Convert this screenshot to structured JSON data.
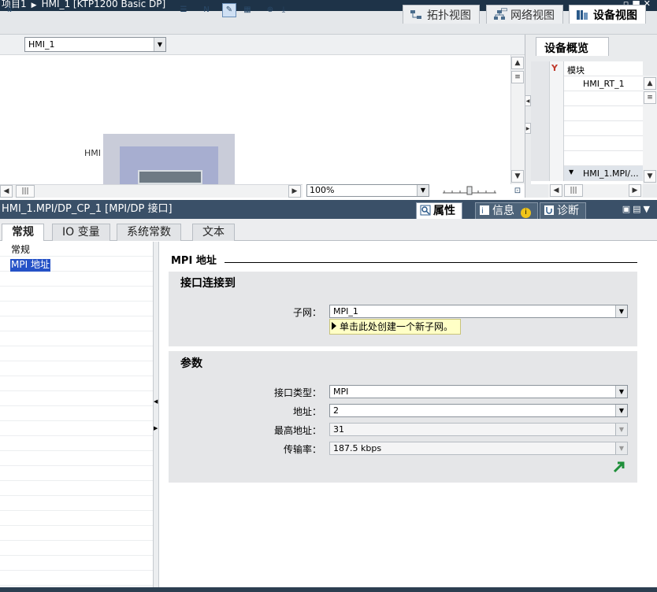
{
  "title": {
    "project": "项目1",
    "device": "HMI_1 [KTP1200 Basic DP]"
  },
  "view_tabs": [
    {
      "label": "拓扑视图",
      "icon": "topology-icon"
    },
    {
      "label": "网络视图",
      "icon": "network-icon"
    },
    {
      "label": "设备视图",
      "icon": "device-icon"
    }
  ],
  "toolbar": {
    "device_select": "HMI_1",
    "zoom": "100%"
  },
  "canvas": {
    "hmi_label": "HMI"
  },
  "overview": {
    "title": "设备概览",
    "column_module": "模块",
    "rows": [
      "HMI_RT_1",
      "",
      "",
      "",
      "",
      "",
      "HMI_1.MPI/..."
    ]
  },
  "inspector": {
    "object_title": "HMI_1.MPI/DP_CP_1 [MPI/DP 接口]",
    "tabs": [
      "属性",
      "信息",
      "诊断"
    ],
    "subtabs": [
      "常规",
      "IO 变量",
      "系统常数",
      "文本"
    ],
    "nav_items": [
      "常规",
      "MPI 地址"
    ]
  },
  "mpi": {
    "section_title": "MPI 地址",
    "connect": {
      "heading": "接口连接到",
      "subnet_label": "子网：",
      "subnet_value": "MPI_1",
      "tooltip": "单击此处创建一个新子网。"
    },
    "params": {
      "heading": "参数",
      "interface_type_label": "接口类型：",
      "interface_type_value": "MPI",
      "address_label": "地址：",
      "address_value": "2",
      "highest_label": "最高地址：",
      "highest_value": "31",
      "rate_label": "传输率：",
      "rate_value": "187.5 kbps"
    }
  },
  "colors": {
    "title_bg": "#1e3348",
    "inspector_bg": "#3a5068",
    "selection": "#2552c7",
    "group_bg": "#e5e6e8",
    "tooltip_bg": "#ffffc6",
    "goto_arrow": "#1f8f3a"
  }
}
